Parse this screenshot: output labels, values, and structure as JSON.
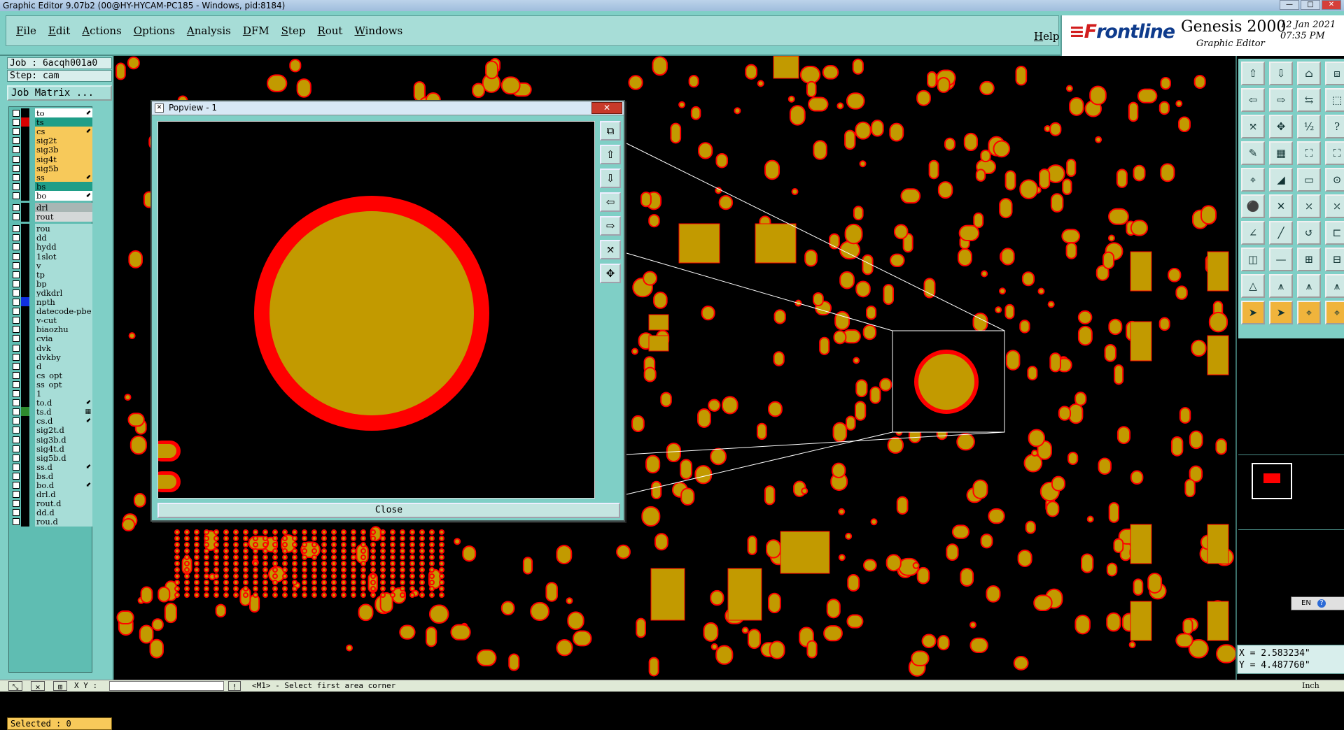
{
  "window": {
    "title": "Graphic Editor 9.07b2 (00@HY-HYCAM-PC185 - Windows, pid:8184)"
  },
  "menu": {
    "items": [
      "File",
      "Edit",
      "Actions",
      "Options",
      "Analysis",
      "DFM",
      "Step",
      "Rout",
      "Windows"
    ],
    "help": "Help"
  },
  "brand": {
    "logo_red": "≡F",
    "logo_blue": "rontline",
    "product": "Genesis 2000",
    "subtitle": "Graphic Editor",
    "date": "12 Jan 2021",
    "time": "07:35 PM"
  },
  "job": {
    "job_label": "Job : 6acqh001a0",
    "step_label": "Step: cam",
    "matrix_button": "Job Matrix ..."
  },
  "layers": [
    {
      "name": "to",
      "bg": "#ffffff",
      "sw": "#000000",
      "mark": "⬋"
    },
    {
      "name": "ts",
      "bg": "#1f9e88",
      "sw": "#d80000",
      "mark": ""
    },
    {
      "name": "cs",
      "bg": "#f7c95a",
      "sw": "#000000",
      "mark": "⬋"
    },
    {
      "name": "sig2t",
      "bg": "#f7c95a",
      "sw": "#000000",
      "mark": ""
    },
    {
      "name": "sig3b",
      "bg": "#f7c95a",
      "sw": "#000000",
      "mark": ""
    },
    {
      "name": "sig4t",
      "bg": "#f7c95a",
      "sw": "#000000",
      "mark": ""
    },
    {
      "name": "sig5b",
      "bg": "#f7c95a",
      "sw": "#000000",
      "mark": ""
    },
    {
      "name": "ss",
      "bg": "#f7c95a",
      "sw": "#000000",
      "mark": "⬋"
    },
    {
      "name": "bs",
      "bg": "#1f9e88",
      "sw": "#000000",
      "mark": ""
    },
    {
      "name": "bo",
      "bg": "#ffffff",
      "sw": "#000000",
      "mark": "⬋"
    },
    {
      "name": "drl",
      "bg": "#a8b6b4",
      "sw": "#000000",
      "mark": "",
      "gap": true
    },
    {
      "name": "rout",
      "bg": "#d4d8d8",
      "sw": "#000000",
      "mark": ""
    },
    {
      "name": "rou",
      "bg": "#a7ddd7",
      "sw": "#000000",
      "mark": "",
      "gap": true
    },
    {
      "name": "dd",
      "bg": "#a7ddd7",
      "sw": "#000000",
      "mark": ""
    },
    {
      "name": "hydd",
      "bg": "#a7ddd7",
      "sw": "#000000",
      "mark": ""
    },
    {
      "name": "1slot",
      "bg": "#a7ddd7",
      "sw": "#000000",
      "mark": ""
    },
    {
      "name": "v",
      "bg": "#a7ddd7",
      "sw": "#000000",
      "mark": ""
    },
    {
      "name": "tp",
      "bg": "#a7ddd7",
      "sw": "#000000",
      "mark": ""
    },
    {
      "name": "bp",
      "bg": "#a7ddd7",
      "sw": "#000000",
      "mark": ""
    },
    {
      "name": "ydkdrl",
      "bg": "#a7ddd7",
      "sw": "#000000",
      "mark": ""
    },
    {
      "name": "npth",
      "bg": "#a7ddd7",
      "sw": "#1030e0",
      "mark": ""
    },
    {
      "name": "datecode-pbe",
      "bg": "#a7ddd7",
      "sw": "#000000",
      "mark": ""
    },
    {
      "name": "v-cut",
      "bg": "#a7ddd7",
      "sw": "#000000",
      "mark": ""
    },
    {
      "name": "biaozhu",
      "bg": "#a7ddd7",
      "sw": "#000000",
      "mark": ""
    },
    {
      "name": "cvia",
      "bg": "#a7ddd7",
      "sw": "#000000",
      "mark": ""
    },
    {
      "name": "dvk",
      "bg": "#a7ddd7",
      "sw": "#000000",
      "mark": ""
    },
    {
      "name": "dvkby",
      "bg": "#a7ddd7",
      "sw": "#000000",
      "mark": ""
    },
    {
      "name": "d",
      "bg": "#a7ddd7",
      "sw": "#000000",
      "mark": ""
    },
    {
      "name": "cs_opt",
      "bg": "#a7ddd7",
      "sw": "#000000",
      "mark": ""
    },
    {
      "name": "ss_opt",
      "bg": "#a7ddd7",
      "sw": "#000000",
      "mark": ""
    },
    {
      "name": "1",
      "bg": "#a7ddd7",
      "sw": "#000000",
      "mark": ""
    },
    {
      "name": "to.d",
      "bg": "#a7ddd7",
      "sw": "#000000",
      "mark": "⬋"
    },
    {
      "name": "ts.d",
      "bg": "#a7ddd7",
      "sw": "#2e8b2e",
      "mark": "▦"
    },
    {
      "name": "cs.d",
      "bg": "#a7ddd7",
      "sw": "#000000",
      "mark": "⬋"
    },
    {
      "name": "sig2t.d",
      "bg": "#a7ddd7",
      "sw": "#000000",
      "mark": ""
    },
    {
      "name": "sig3b.d",
      "bg": "#a7ddd7",
      "sw": "#000000",
      "mark": ""
    },
    {
      "name": "sig4t.d",
      "bg": "#a7ddd7",
      "sw": "#000000",
      "mark": ""
    },
    {
      "name": "sig5b.d",
      "bg": "#a7ddd7",
      "sw": "#000000",
      "mark": ""
    },
    {
      "name": "ss.d",
      "bg": "#a7ddd7",
      "sw": "#000000",
      "mark": "⬋"
    },
    {
      "name": "bs.d",
      "bg": "#a7ddd7",
      "sw": "#000000",
      "mark": ""
    },
    {
      "name": "bo.d",
      "bg": "#a7ddd7",
      "sw": "#000000",
      "mark": "⬋"
    },
    {
      "name": "drl.d",
      "bg": "#a7ddd7",
      "sw": "#000000",
      "mark": ""
    },
    {
      "name": "rout.d",
      "bg": "#a7ddd7",
      "sw": "#000000",
      "mark": ""
    },
    {
      "name": "dd.d",
      "bg": "#a7ddd7",
      "sw": "#000000",
      "mark": ""
    },
    {
      "name": "rou.d",
      "bg": "#a7ddd7",
      "sw": "#000000",
      "mark": ""
    }
  ],
  "selected": "Selected : 0",
  "popview": {
    "title": "Popview - 1",
    "close_x": "✕",
    "close_button": "Close"
  },
  "coords": {
    "x": "X = 2.583234\"",
    "y": "Y = 4.487760\""
  },
  "status": {
    "xy_label": "X Y :",
    "xy_value": "",
    "message": "<M1> - Select first area corner",
    "units": "Inch"
  },
  "lang": {
    "code": "EN",
    "help": "?"
  },
  "colors": {
    "pad_fill": "#c29a00",
    "pad_ring": "#ff0000",
    "panel": "#7fcfc6",
    "accent_orange": "#f7c95a"
  }
}
